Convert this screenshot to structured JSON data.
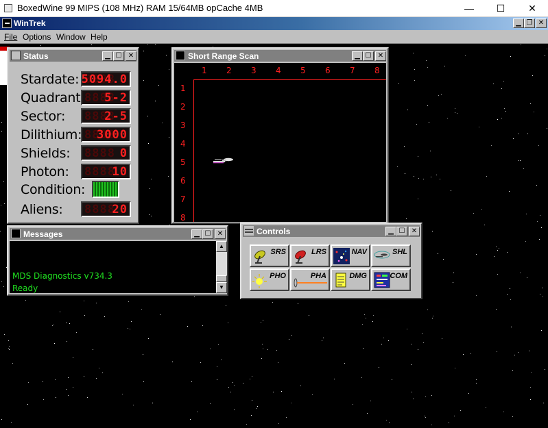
{
  "host": {
    "title": "BoxedWine 99 MIPS (108 MHz) RAM 15/64MB opCache 4MB",
    "minimize": "—",
    "maximize": "☐",
    "close": "✕"
  },
  "app": {
    "title": "WinTrek",
    "menu": [
      "File",
      "Options",
      "Window",
      "Help"
    ]
  },
  "status": {
    "title": "Status",
    "stardate_label": "Stardate:",
    "stardate": "5094.0",
    "quadrant_label": "Quadrant:",
    "quadrant": "5-2",
    "sector_label": "Sector:",
    "sector": "2-5",
    "dilithium_label": "Dilithium:",
    "dilithium": "3000",
    "shields_label": "Shields:",
    "shields": "0",
    "photon_label": "Photon:",
    "photon": "10",
    "condition_label": "Condition:",
    "condition_color": "#20c020",
    "aliens_label": "Aliens:",
    "aliens": "20",
    "led_ghost": "8888"
  },
  "srs": {
    "title": "Short Range Scan",
    "columns": [
      "1",
      "2",
      "3",
      "4",
      "5",
      "6",
      "7",
      "8"
    ],
    "rows": [
      "1",
      "2",
      "3",
      "4",
      "5",
      "6",
      "7",
      "8"
    ],
    "ship": {
      "row": 5,
      "col": 2
    }
  },
  "messages": {
    "title": "Messages",
    "lines": [
      "MDS Diagnostics v734.3",
      "Ready"
    ]
  },
  "controls": {
    "title": "Controls",
    "buttons": [
      {
        "label": "SRS",
        "icon": "satellite-dish-icon"
      },
      {
        "label": "LRS",
        "icon": "radar-dish-icon"
      },
      {
        "label": "NAV",
        "icon": "starfield-icon"
      },
      {
        "label": "SHL",
        "icon": "starship-icon"
      },
      {
        "label": "PHO",
        "icon": "photon-burst-icon"
      },
      {
        "label": "PHA",
        "icon": "phaser-beam-icon"
      },
      {
        "label": "DMG",
        "icon": "notepad-icon"
      },
      {
        "label": "COM",
        "icon": "computer-screen-icon"
      }
    ]
  }
}
